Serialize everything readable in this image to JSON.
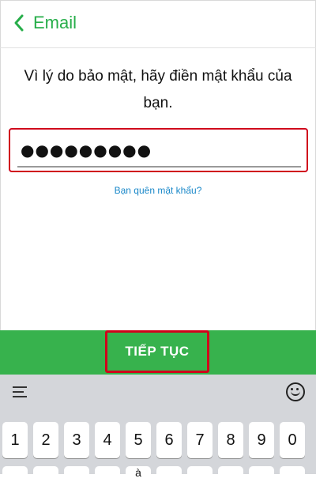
{
  "header": {
    "title": "Email"
  },
  "message": "Vì lý do bảo mật, hãy điền mật khẩu của bạn.",
  "password": {
    "value": "●●●●●●●●●"
  },
  "forgot_link": "Bạn quên mật khẩu?",
  "continue_label": "TIẾP TỤC",
  "keyboard": {
    "number_row": [
      "1",
      "2",
      "3",
      "4",
      "5",
      "6",
      "7",
      "8",
      "9",
      "0"
    ],
    "second_row_partial": [
      "",
      "",
      "",
      "",
      "à",
      "",
      "",
      "",
      "",
      ""
    ],
    "menu_icon": "hamburger-icon",
    "emoji_icon": "smiley-icon"
  },
  "colors": {
    "accent": "#27ae4a",
    "button_bg": "#37b24d",
    "highlight": "#d0021b",
    "link": "#1a88c9"
  }
}
